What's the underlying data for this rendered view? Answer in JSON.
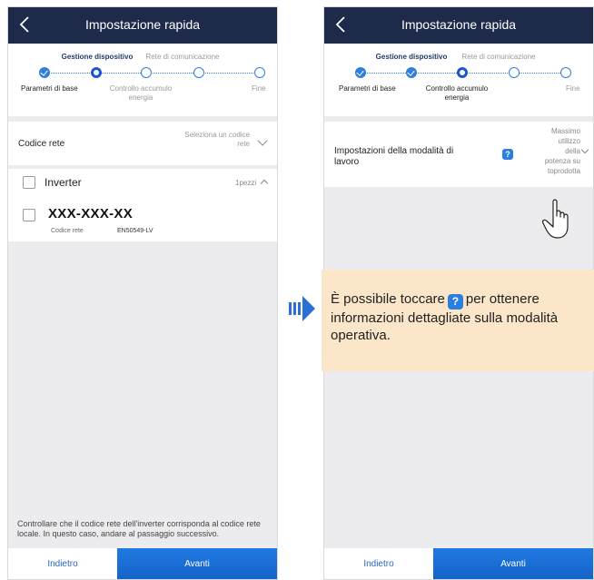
{
  "left": {
    "header_title": "Impostazione rapida",
    "stepper": {
      "tab_active": "Gestione dispositivo",
      "tab_inactive": "Rete di comunicazione",
      "step1": "Parametri di base",
      "step2_line1": "Controllo accumulo",
      "step2_line2": "energia",
      "step3": "Fine"
    },
    "grid_code": {
      "label": "Codice rete",
      "hint_line1": "Seleziona un codice",
      "hint_line2": "rete"
    },
    "inverter": {
      "label": "Inverter",
      "count": "1pezzi",
      "serial": "XXX-XXX-XX",
      "sub_label": "Codice rete",
      "sub_value": "EN50549-LV"
    },
    "footer_note": "Controllare che il codice rete dell'inverter corrisponda al codice rete locale. In questo caso, andare al passaggio successivo.",
    "back_button": "Indietro",
    "next_button": "Avanti"
  },
  "right": {
    "header_title": "Impostazione rapida",
    "stepper": {
      "tab_active": "Gestione dispositivo",
      "tab_inactive": "Rete di comunicazione",
      "step1": "Parametri di base",
      "step2_line1": "Controllo accumulo",
      "step2_line2": "energia",
      "step3": "Fine"
    },
    "mode": {
      "label_line1": "Impostazioni della modalità di",
      "label_line2": "lavoro",
      "help_glyph": "?",
      "value_line1": "Massimo",
      "value_line2": "utilizzo",
      "value_line3": "della",
      "value_line4": "potenza su",
      "value_line5": "toprodotta"
    },
    "back_button": "Indietro",
    "next_button": "Avanti"
  },
  "callout": {
    "text_before": "È possibile toccare",
    "help_glyph": "?",
    "text_after": "per ottenere informazioni dettagliate sulla modalità operativa."
  },
  "icons": {
    "back": "chevron-left-icon",
    "help": "question-mark-icon",
    "arrow": "arrow-right-icon",
    "hand": "pointing-hand-icon"
  },
  "colors": {
    "header": "#1d2a4a",
    "accent": "#2f7fdb",
    "next_button": "#1f79e2",
    "callout": "#fbe6c9"
  }
}
